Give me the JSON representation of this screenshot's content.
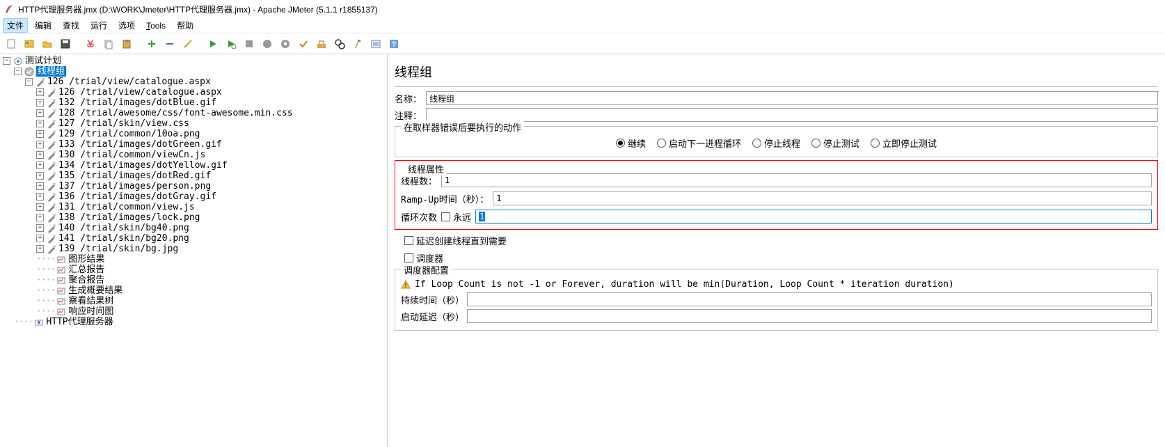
{
  "window": {
    "title": "HTTP代理服务器.jmx (D:\\WORK\\Jmeter\\HTTP代理服务器.jmx) - Apache JMeter (5.1.1 r1855137)"
  },
  "menubar": {
    "items": [
      "文件",
      "编辑",
      "查找",
      "运行",
      "选项",
      "Tools",
      "帮助"
    ],
    "underline": [
      null,
      null,
      null,
      null,
      null,
      0,
      null
    ],
    "selected": 0
  },
  "tree": {
    "root": "测试计划",
    "thread_group": "线程组",
    "samplers": [
      "126 /trial/view/catalogue.aspx",
      "126 /trial/view/catalogue.aspx",
      "132 /trial/images/dotBlue.gif",
      "128 /trial/awesome/css/font-awesome.min.css",
      "127 /trial/skin/view.css",
      "129 /trial/common/10oa.png",
      "133 /trial/images/dotGreen.gif",
      "130 /trial/common/viewCn.js",
      "134 /trial/images/dotYellow.gif",
      "135 /trial/images/dotRed.gif",
      "137 /trial/images/person.png",
      "136 /trial/images/dotGray.gif",
      "131 /trial/common/view.js",
      "138 /trial/images/lock.png",
      "140 /trial/skin/bg40.png",
      "141 /trial/skin/bg20.png",
      "139 /trial/skin/bg.jpg"
    ],
    "listeners": [
      "图形结果",
      "汇总报告",
      "聚合报告",
      "生成概要结果",
      "察看结果树",
      "响应时间图"
    ],
    "proxy": "HTTP代理服务器"
  },
  "content": {
    "panel_title": "线程组",
    "name_label": "名称：",
    "name_value": "线程组",
    "comment_label": "注释：",
    "comment_value": "",
    "on_error_legend": "在取样器错误后要执行的动作",
    "on_error_options": [
      "继续",
      "启动下一进程循环",
      "停止线程",
      "停止测试",
      "立即停止测试"
    ],
    "on_error_selected": 0,
    "thread_props_legend": "线程属性",
    "threads_label": "线程数：",
    "threads_value": "1",
    "rampup_label": "Ramp-Up时间（秒）：",
    "rampup_value": "1",
    "loop_label": "循环次数",
    "forever_label": "永远",
    "loop_value": "1",
    "delay_create_label": "延迟创建线程直到需要",
    "scheduler_label": "调度器",
    "scheduler_cfg_legend": "调度器配置",
    "warn_text": "If Loop Count is not -1 or Forever, duration will be min(Duration, Loop Count * iteration duration)",
    "duration_label": "持续时间（秒）",
    "startup_delay_label": "启动延迟（秒）"
  }
}
